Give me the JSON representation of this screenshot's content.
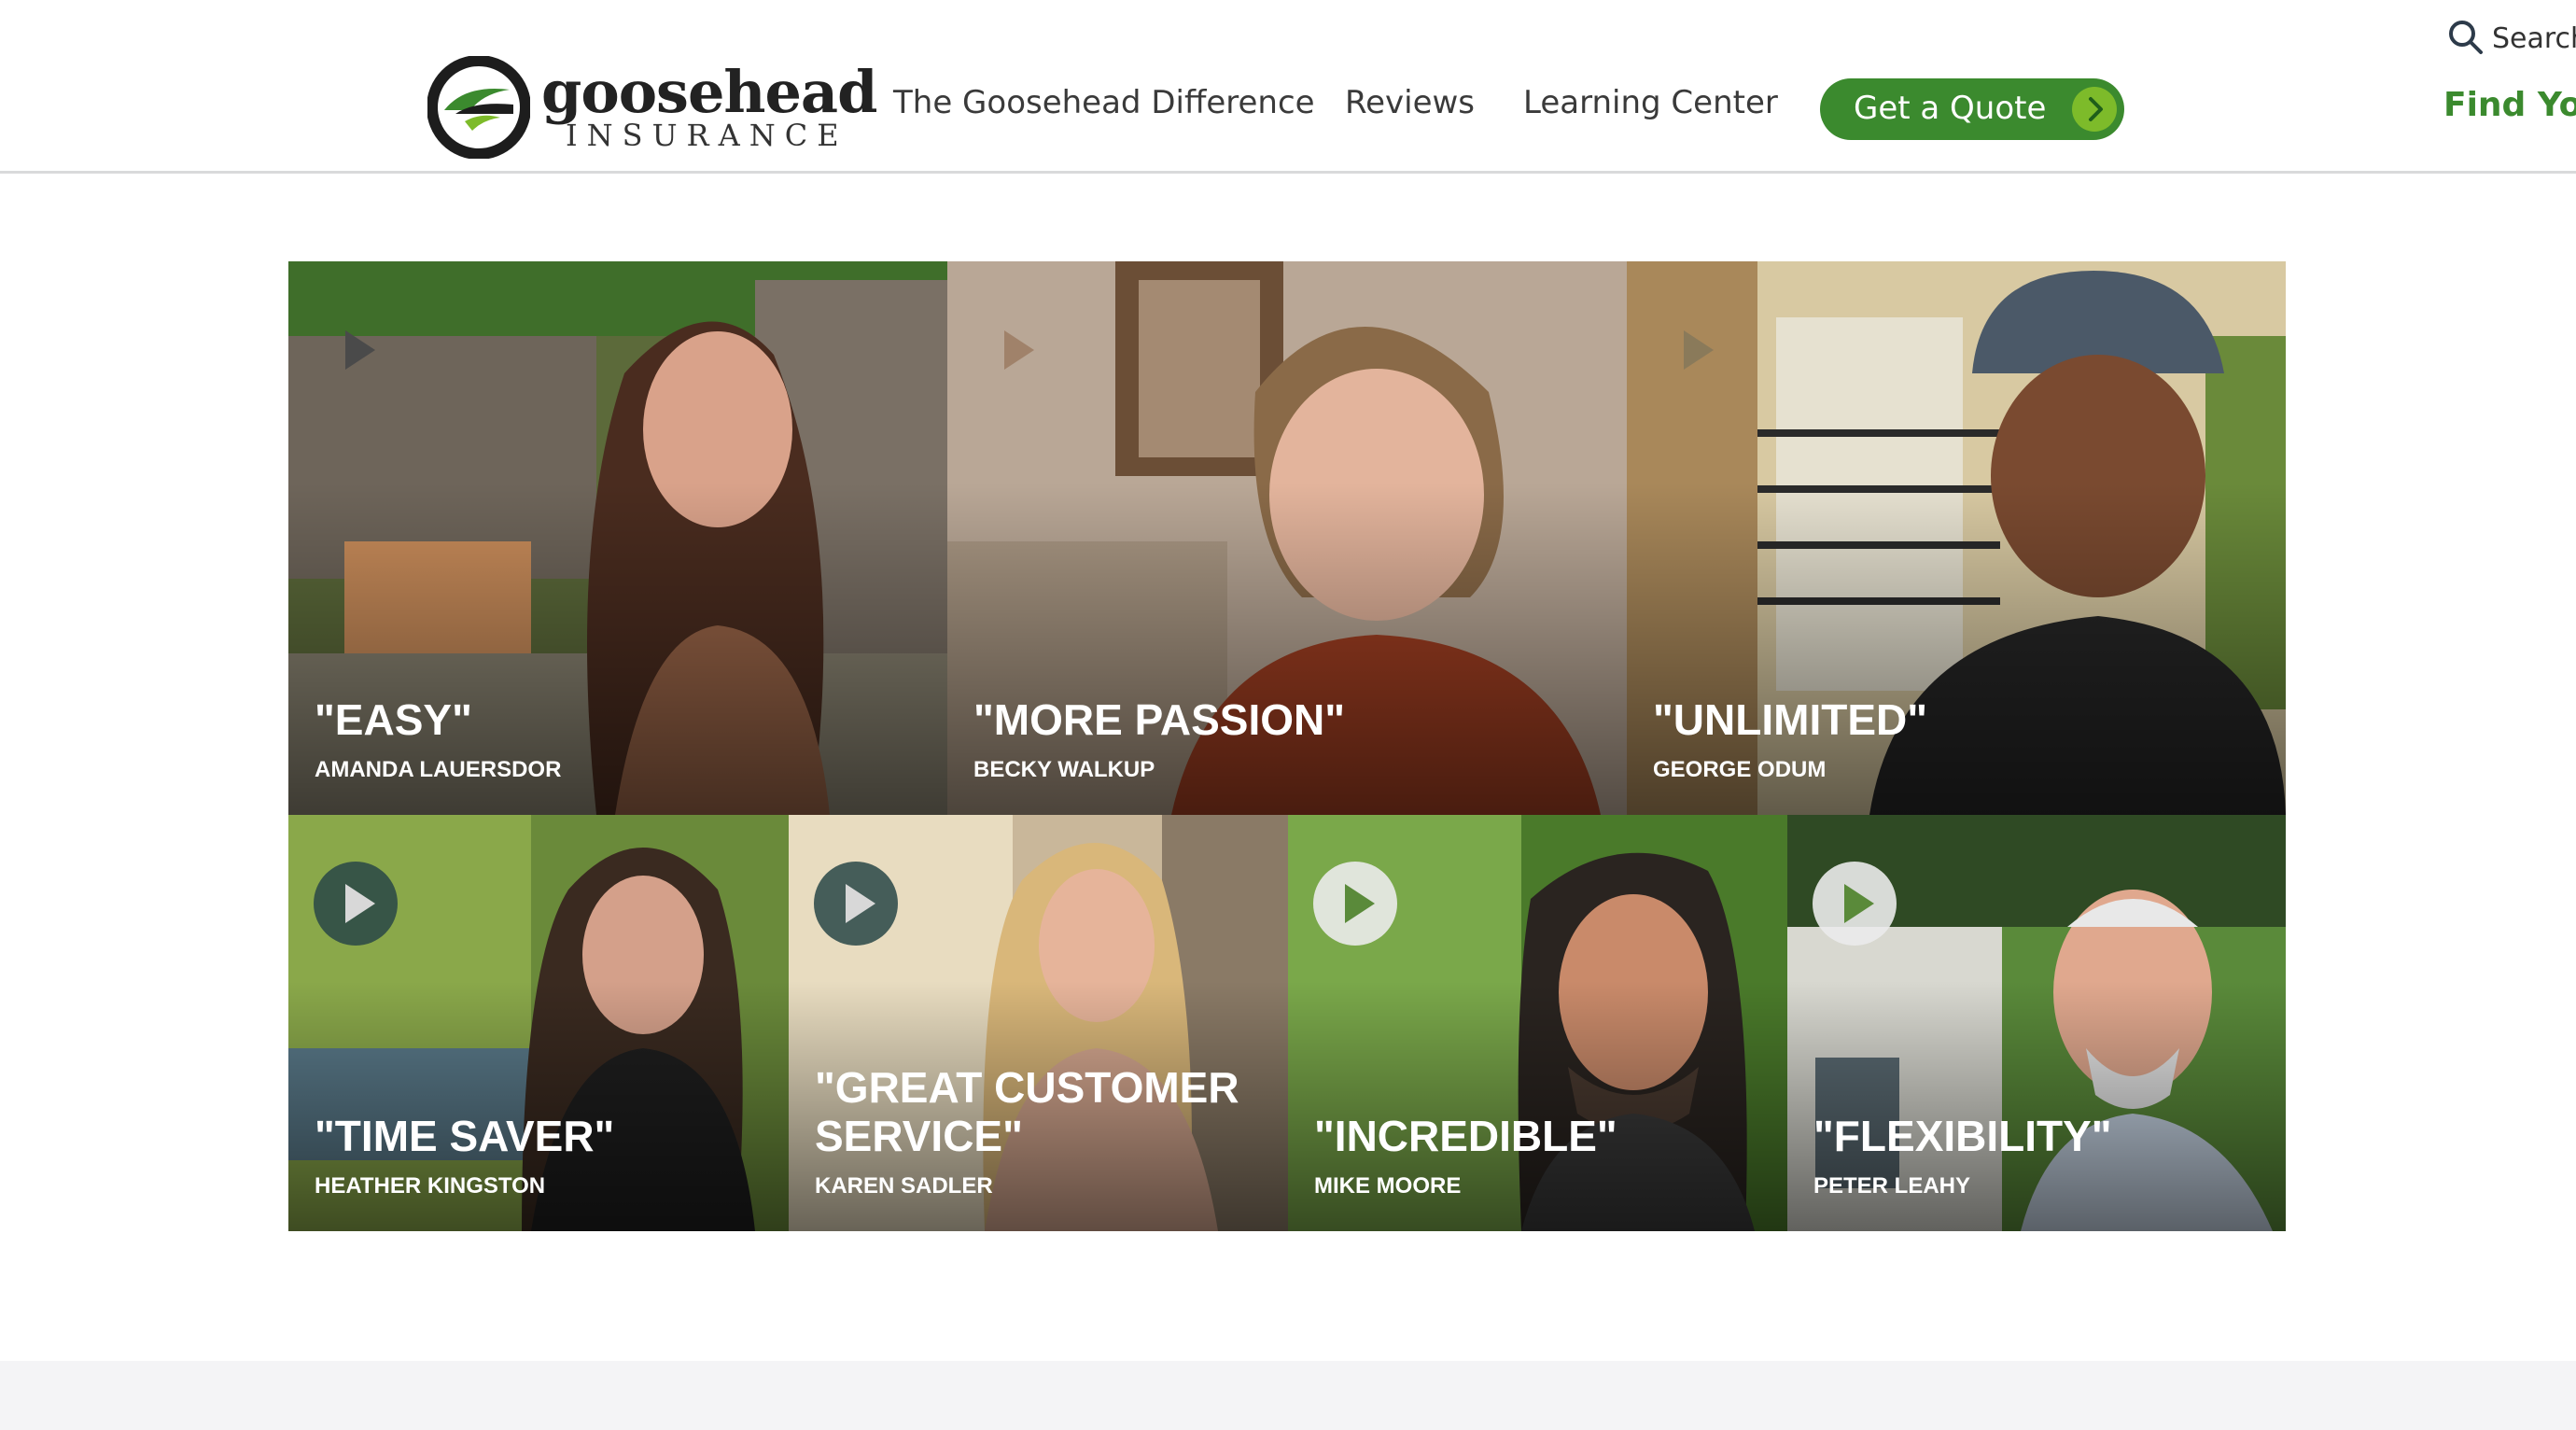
{
  "header": {
    "logo": {
      "name": "goosehead",
      "sub": "INSURANCE",
      "icon": "goosehead-g-logo-icon"
    },
    "nav": [
      "The Goosehead Difference",
      "Reviews",
      "Learning Center"
    ],
    "quote_button": "Get a Quote",
    "search_label": "Search",
    "find_link": "Find You"
  },
  "colors": {
    "brand_green": "#3b8a2e",
    "accent_lime": "#7dbb2a",
    "text_dark": "#3a3a3a"
  },
  "videos": [
    {
      "quote": "\"EASY\"",
      "name": "AMANDA LAUERSDOR",
      "play_style": "light"
    },
    {
      "quote": "\"MORE PASSION\"",
      "name": "BECKY WALKUP",
      "play_style": "light"
    },
    {
      "quote": "\"UNLIMITED\"",
      "name": "GEORGE ODUM",
      "play_style": "light"
    },
    {
      "quote": "\"TIME SAVER\"",
      "name": "HEATHER KINGSTON",
      "play_style": "dark"
    },
    {
      "quote": "\"GREAT CUSTOMER SERVICE\"",
      "name": "KAREN SADLER",
      "play_style": "dark"
    },
    {
      "quote": "\"INCREDIBLE\"",
      "name": "MIKE MOORE",
      "play_style": "light"
    },
    {
      "quote": "\"FLEXIBILITY\"",
      "name": "PETER LEAHY",
      "play_style": "light"
    }
  ]
}
